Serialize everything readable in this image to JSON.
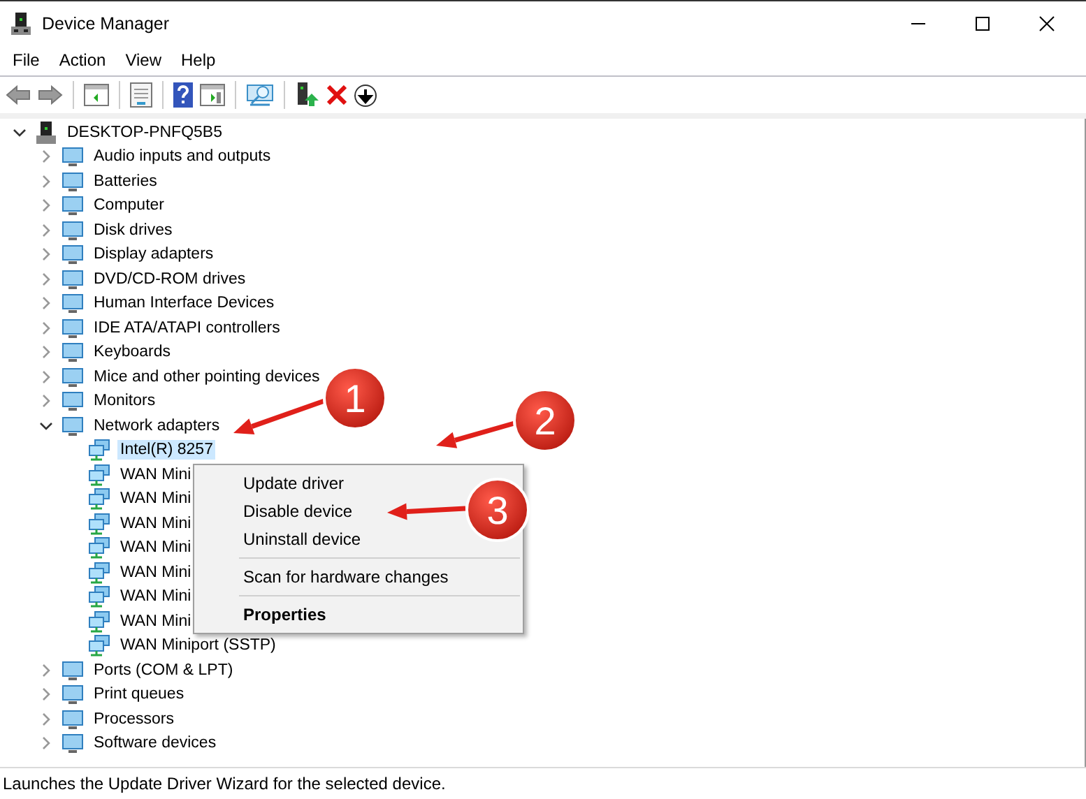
{
  "window": {
    "title": "Device Manager"
  },
  "menu_bar": [
    "File",
    "Action",
    "View",
    "Help"
  ],
  "tree": {
    "label": "DESKTOP-PNFQ5B5",
    "expanded": true,
    "selected": false,
    "children": [
      {
        "label": "Audio inputs and outputs",
        "expanded": false,
        "selected": false
      },
      {
        "label": "Batteries",
        "expanded": false,
        "selected": false
      },
      {
        "label": "Computer",
        "expanded": false,
        "selected": false
      },
      {
        "label": "Disk drives",
        "expanded": false,
        "selected": false
      },
      {
        "label": "Display adapters",
        "expanded": false,
        "selected": false
      },
      {
        "label": "DVD/CD-ROM drives",
        "expanded": false,
        "selected": false
      },
      {
        "label": "Human Interface Devices",
        "expanded": false,
        "selected": false
      },
      {
        "label": "IDE ATA/ATAPI controllers",
        "expanded": false,
        "selected": false
      },
      {
        "label": "Keyboards",
        "expanded": false,
        "selected": false
      },
      {
        "label": "Mice and other pointing devices",
        "expanded": false,
        "selected": false
      },
      {
        "label": "Monitors",
        "expanded": false,
        "selected": false
      },
      {
        "label": "Network adapters",
        "expanded": true,
        "selected": false,
        "children": [
          {
            "label": "Intel(R) 8257",
            "selected": true
          },
          {
            "label": "WAN Mini",
            "selected": false
          },
          {
            "label": "WAN Mini",
            "selected": false
          },
          {
            "label": "WAN Mini",
            "selected": false
          },
          {
            "label": "WAN Mini",
            "selected": false
          },
          {
            "label": "WAN Mini",
            "selected": false
          },
          {
            "label": "WAN Mini",
            "selected": false
          },
          {
            "label": "WAN Mini",
            "selected": false
          },
          {
            "label": "WAN Miniport (SSTP)",
            "selected": false
          }
        ]
      },
      {
        "label": "Ports (COM & LPT)",
        "expanded": false,
        "selected": false
      },
      {
        "label": "Print queues",
        "expanded": false,
        "selected": false
      },
      {
        "label": "Processors",
        "expanded": false,
        "selected": false
      },
      {
        "label": "Software devices",
        "expanded": false,
        "selected": false
      }
    ]
  },
  "context_menu": {
    "groups": [
      [
        {
          "label": "Update driver",
          "default": false
        },
        {
          "label": "Disable device",
          "default": false
        },
        {
          "label": "Uninstall device",
          "default": false
        }
      ],
      [
        {
          "label": "Scan for hardware changes",
          "default": false
        }
      ],
      [
        {
          "label": "Properties",
          "default": true
        }
      ]
    ]
  },
  "annotations": [
    "1",
    "2",
    "3"
  ],
  "status_bar": "Launches the Update Driver Wizard for the selected device."
}
